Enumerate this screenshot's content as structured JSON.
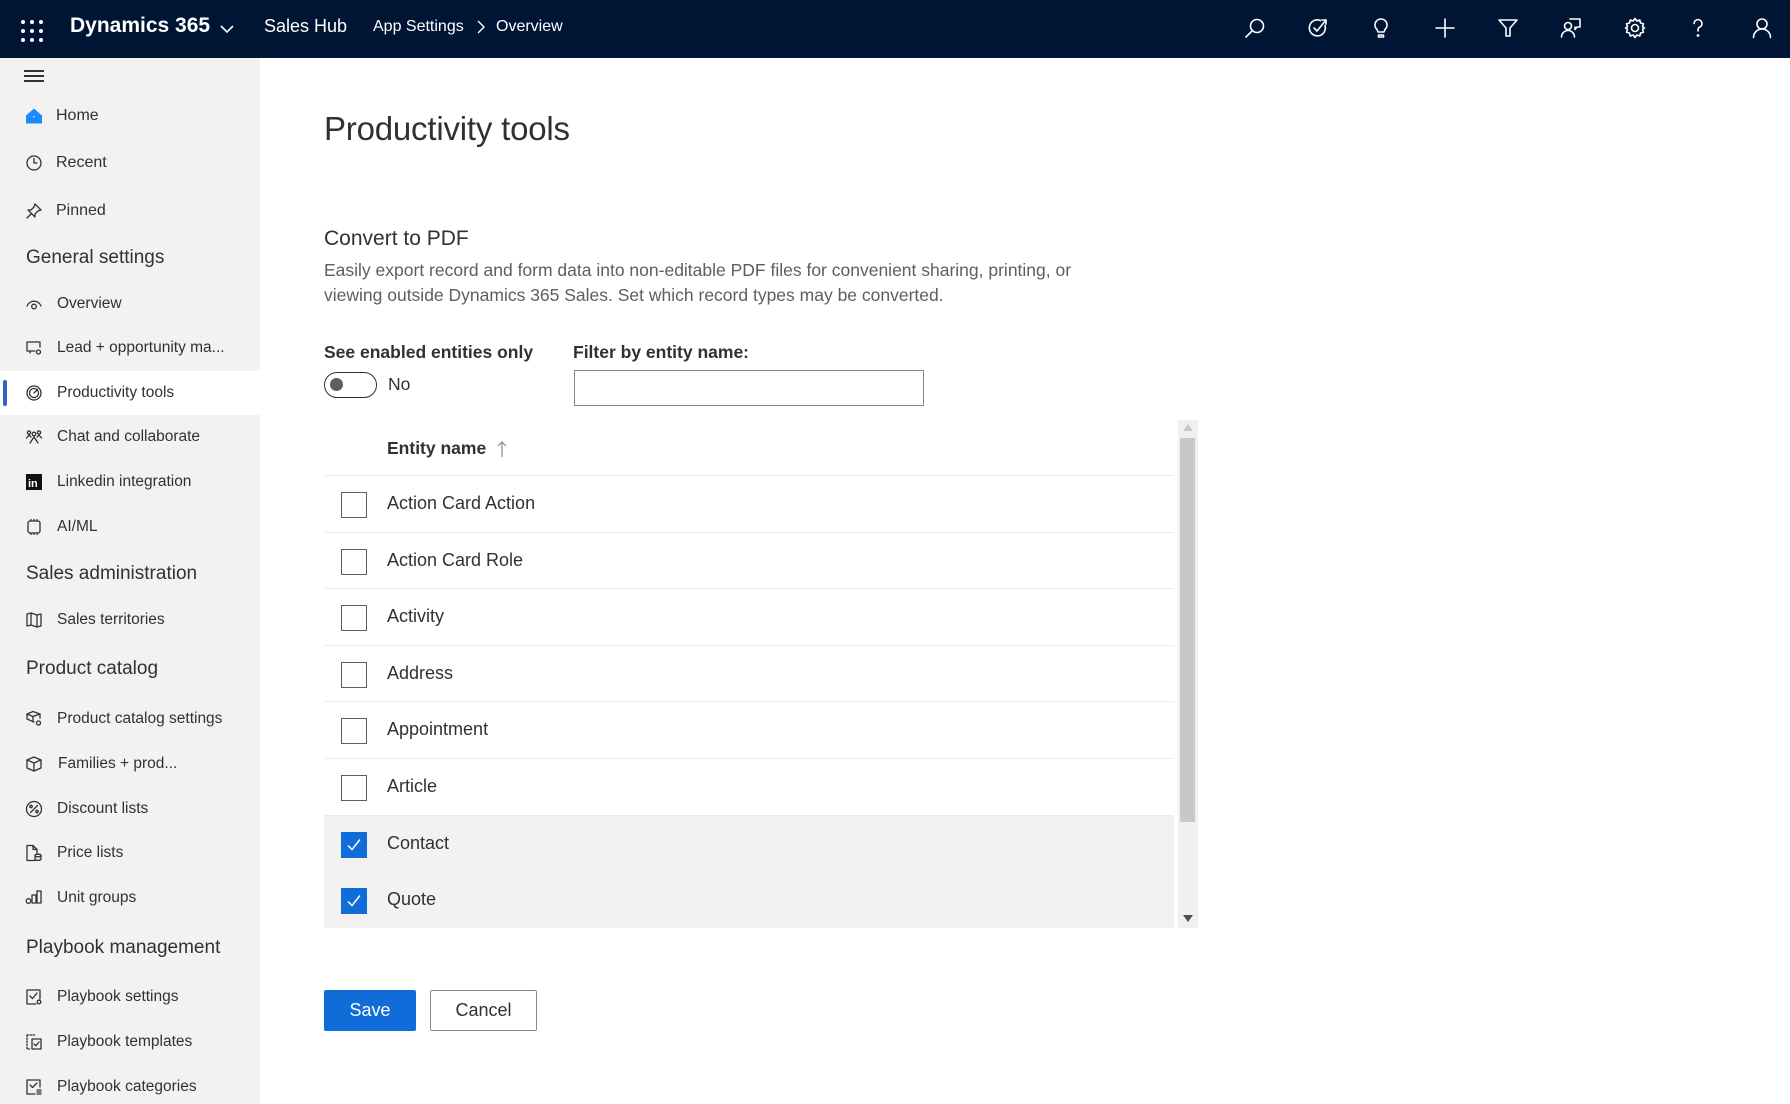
{
  "topbar": {
    "brand": "Dynamics 365",
    "app_name": "Sales Hub",
    "breadcrumb": [
      "App Settings",
      "Overview"
    ],
    "icons": [
      "search-icon",
      "task-icon",
      "lightbulb-icon",
      "add-icon",
      "filter-icon",
      "assistant-icon",
      "settings-icon",
      "help-icon",
      "user-icon"
    ]
  },
  "sidebar": {
    "top_items": [
      {
        "label": "Home",
        "icon": "home-icon"
      },
      {
        "label": "Recent",
        "icon": "clock-icon"
      },
      {
        "label": "Pinned",
        "icon": "pin-icon"
      }
    ],
    "groups": [
      {
        "title": "General settings",
        "items": [
          {
            "label": "Overview",
            "icon": "eye-icon"
          },
          {
            "label": "Lead + opportunity ma...",
            "icon": "monitor-gear-icon"
          },
          {
            "label": "Productivity tools",
            "icon": "gauge-icon",
            "selected": true
          },
          {
            "label": "Chat and collaborate",
            "icon": "people-icon"
          },
          {
            "label": "Linkedin integration",
            "icon": "linkedin-icon"
          },
          {
            "label": "AI/ML",
            "icon": "chip-icon"
          }
        ]
      },
      {
        "title": "Sales administration",
        "items": [
          {
            "label": "Sales territories",
            "icon": "map-icon"
          }
        ]
      },
      {
        "title": "Product catalog",
        "items": [
          {
            "label": "Product catalog settings",
            "icon": "box-gear-icon"
          },
          {
            "label": "Families + prod...",
            "icon": "box-icon"
          },
          {
            "label": "Discount lists",
            "icon": "percent-icon"
          },
          {
            "label": "Price lists",
            "icon": "price-list-icon"
          },
          {
            "label": "Unit groups",
            "icon": "unit-groups-icon"
          }
        ]
      },
      {
        "title": "Playbook management",
        "items": [
          {
            "label": "Playbook settings",
            "icon": "playbook-settings-icon"
          },
          {
            "label": "Playbook templates",
            "icon": "playbook-templates-icon"
          },
          {
            "label": "Playbook categories",
            "icon": "playbook-categories-icon"
          }
        ]
      }
    ]
  },
  "main": {
    "title": "Productivity tools",
    "section": {
      "title": "Convert to PDF",
      "description": "Easily export record and form data into non-editable PDF files for convenient sharing, printing, or viewing outside Dynamics 365 Sales. Set which record types may be converted."
    },
    "toggle": {
      "label": "See enabled entities only",
      "state": "No",
      "on": false
    },
    "filter": {
      "label": "Filter by entity name:",
      "value": "",
      "placeholder": ""
    },
    "grid": {
      "column": "Entity name",
      "sort": "ascending",
      "rows": [
        {
          "name": "Action Card Action",
          "checked": false
        },
        {
          "name": "Action Card Role",
          "checked": false
        },
        {
          "name": "Activity",
          "checked": false
        },
        {
          "name": "Address",
          "checked": false
        },
        {
          "name": "Appointment",
          "checked": false
        },
        {
          "name": "Article",
          "checked": false
        },
        {
          "name": "Contact",
          "checked": true
        },
        {
          "name": "Quote",
          "checked": true
        }
      ]
    },
    "buttons": {
      "save": "Save",
      "cancel": "Cancel"
    }
  },
  "colors": {
    "topbar_bg": "#001433",
    "sidebar_bg": "#f3f2f1",
    "accent": "#0f6cd9",
    "selected_indicator": "#2b66c0",
    "home_icon": "#1a8cff"
  }
}
